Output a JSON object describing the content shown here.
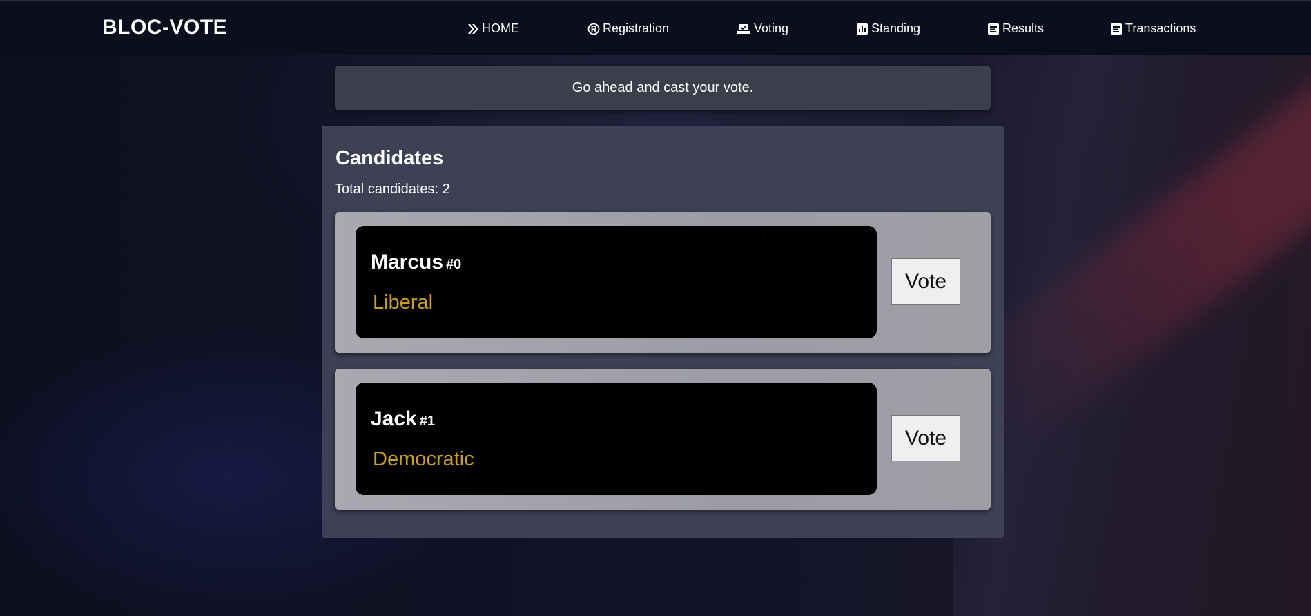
{
  "brand": "BLOC-VOTE",
  "nav": [
    {
      "label": "HOME",
      "icon": "chevron-double-right-icon"
    },
    {
      "label": "Registration",
      "icon": "registered-icon"
    },
    {
      "label": "Voting",
      "icon": "ballot-box-icon"
    },
    {
      "label": "Standing",
      "icon": "bar-chart-icon"
    },
    {
      "label": "Results",
      "icon": "document-list-icon"
    },
    {
      "label": "Transactions",
      "icon": "document-list-icon"
    }
  ],
  "alert": {
    "message": "Go ahead and cast your vote."
  },
  "candidates_panel": {
    "title": "Candidates",
    "total_label": "Total candidates: 2",
    "candidates": [
      {
        "name": "Marcus",
        "id": "#0",
        "party": "Liberal",
        "vote_label": "Vote"
      },
      {
        "name": "Jack",
        "id": "#1",
        "party": "Democratic",
        "vote_label": "Vote"
      }
    ]
  },
  "colors": {
    "party_text": "#c9a12a",
    "navbar_bg": "#0b0f1d",
    "panel_bg": "#424458",
    "card_bg": "#a3a3ab"
  }
}
